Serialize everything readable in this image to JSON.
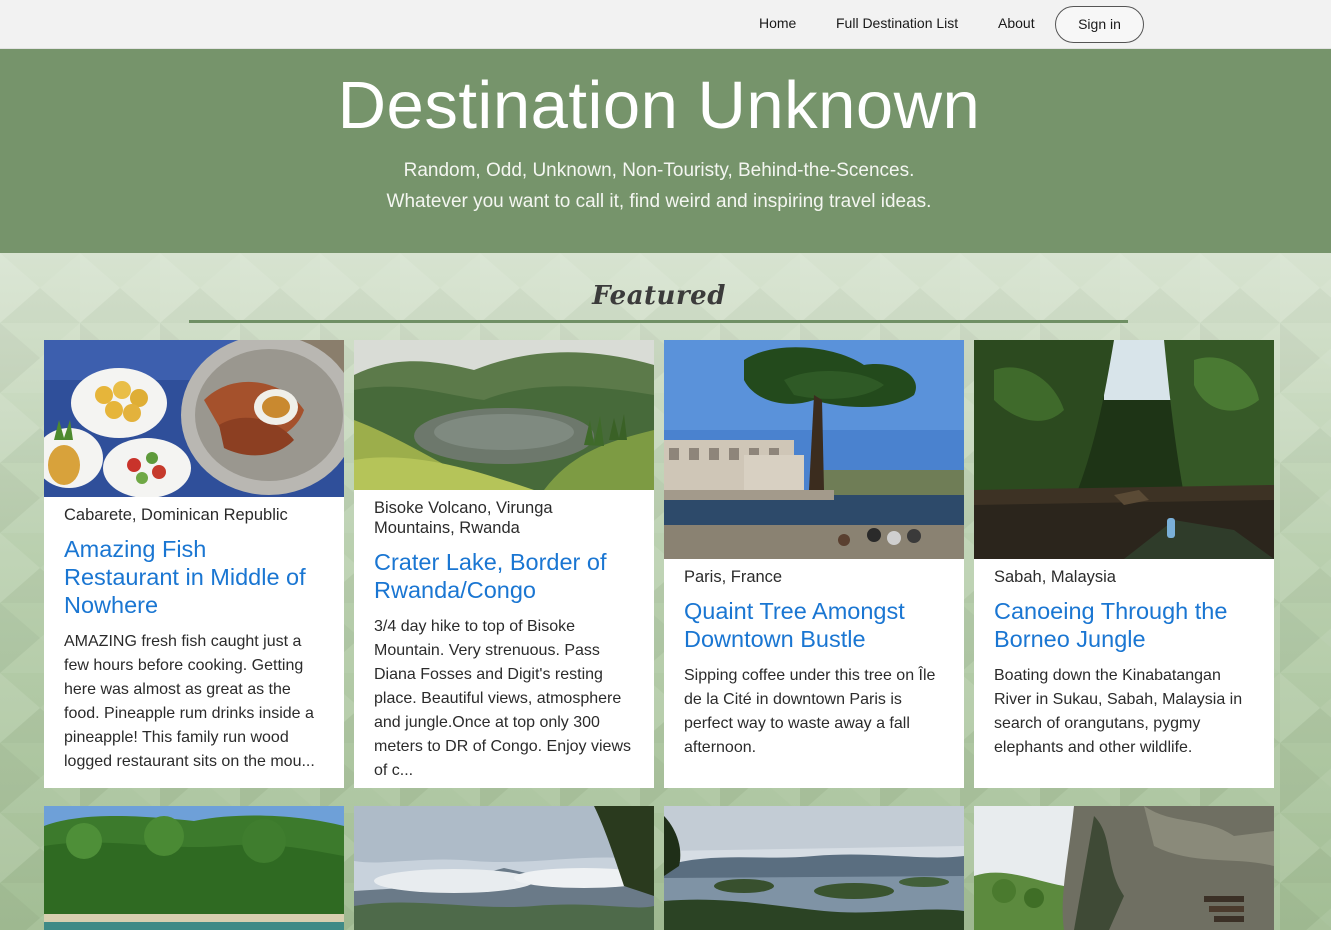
{
  "nav": {
    "home": "Home",
    "full_list": "Full Destination List",
    "about": "About",
    "sign_in": "Sign in"
  },
  "hero": {
    "title": "Destination Unknown",
    "subtitle_line1": "Random, Odd, Unknown, Non-Touristy, Behind-the-Scences.",
    "subtitle_line2": "Whatever you want to call it, find weird and inspiring travel ideas."
  },
  "featured": {
    "heading": "Featured",
    "cards": [
      {
        "location": "Cabarete, Dominican Republic",
        "title": "Amazing Fish Restaurant in Middle of Nowhere",
        "description": "AMAZING fresh fish caught just a few hours before cooking. Getting here was almost as great as the food. Pineapple rum drinks inside a pineapple! This family run wood logged restaurant sits on the mou...",
        "image": "seafood-plate-photo"
      },
      {
        "location": "Bisoke Volcano, Virunga Mountains, Rwanda",
        "title": "Crater Lake, Border of Rwanda/Congo",
        "description": "3/4 day hike to top of Bisoke Mountain. Very strenuous. Pass Diana Fosses and Digit's resting place. Beautiful views, atmosphere and jungle.Once at top only 300 meters to DR of Congo. Enjoy views of c...",
        "image": "crater-lake-photo"
      },
      {
        "location": "Paris, France",
        "title": "Quaint Tree Amongst Downtown Bustle",
        "description": "Sipping coffee under this tree on Île de la Cité in downtown Paris is perfect way to waste away a fall afternoon.",
        "image": "paris-tree-photo"
      },
      {
        "location": "Sabah, Malaysia",
        "title": "Canoeing Through the Borneo Jungle",
        "description": "Boating down the Kinabatangan River in Sukau, Sabah, Malaysia in search of orangutans, pygmy elephants and other wildlife.",
        "image": "jungle-river-photo"
      }
    ],
    "row2_images": [
      "tropical-island-photo",
      "mountain-clouds-photo",
      "lake-islands-photo",
      "limestone-cliff-photo"
    ]
  },
  "colors": {
    "hero_bg": "#76946b",
    "accent_rule": "#6f8f64",
    "link_blue": "#1a76d2",
    "navbar_bg": "#f2f2f2"
  }
}
